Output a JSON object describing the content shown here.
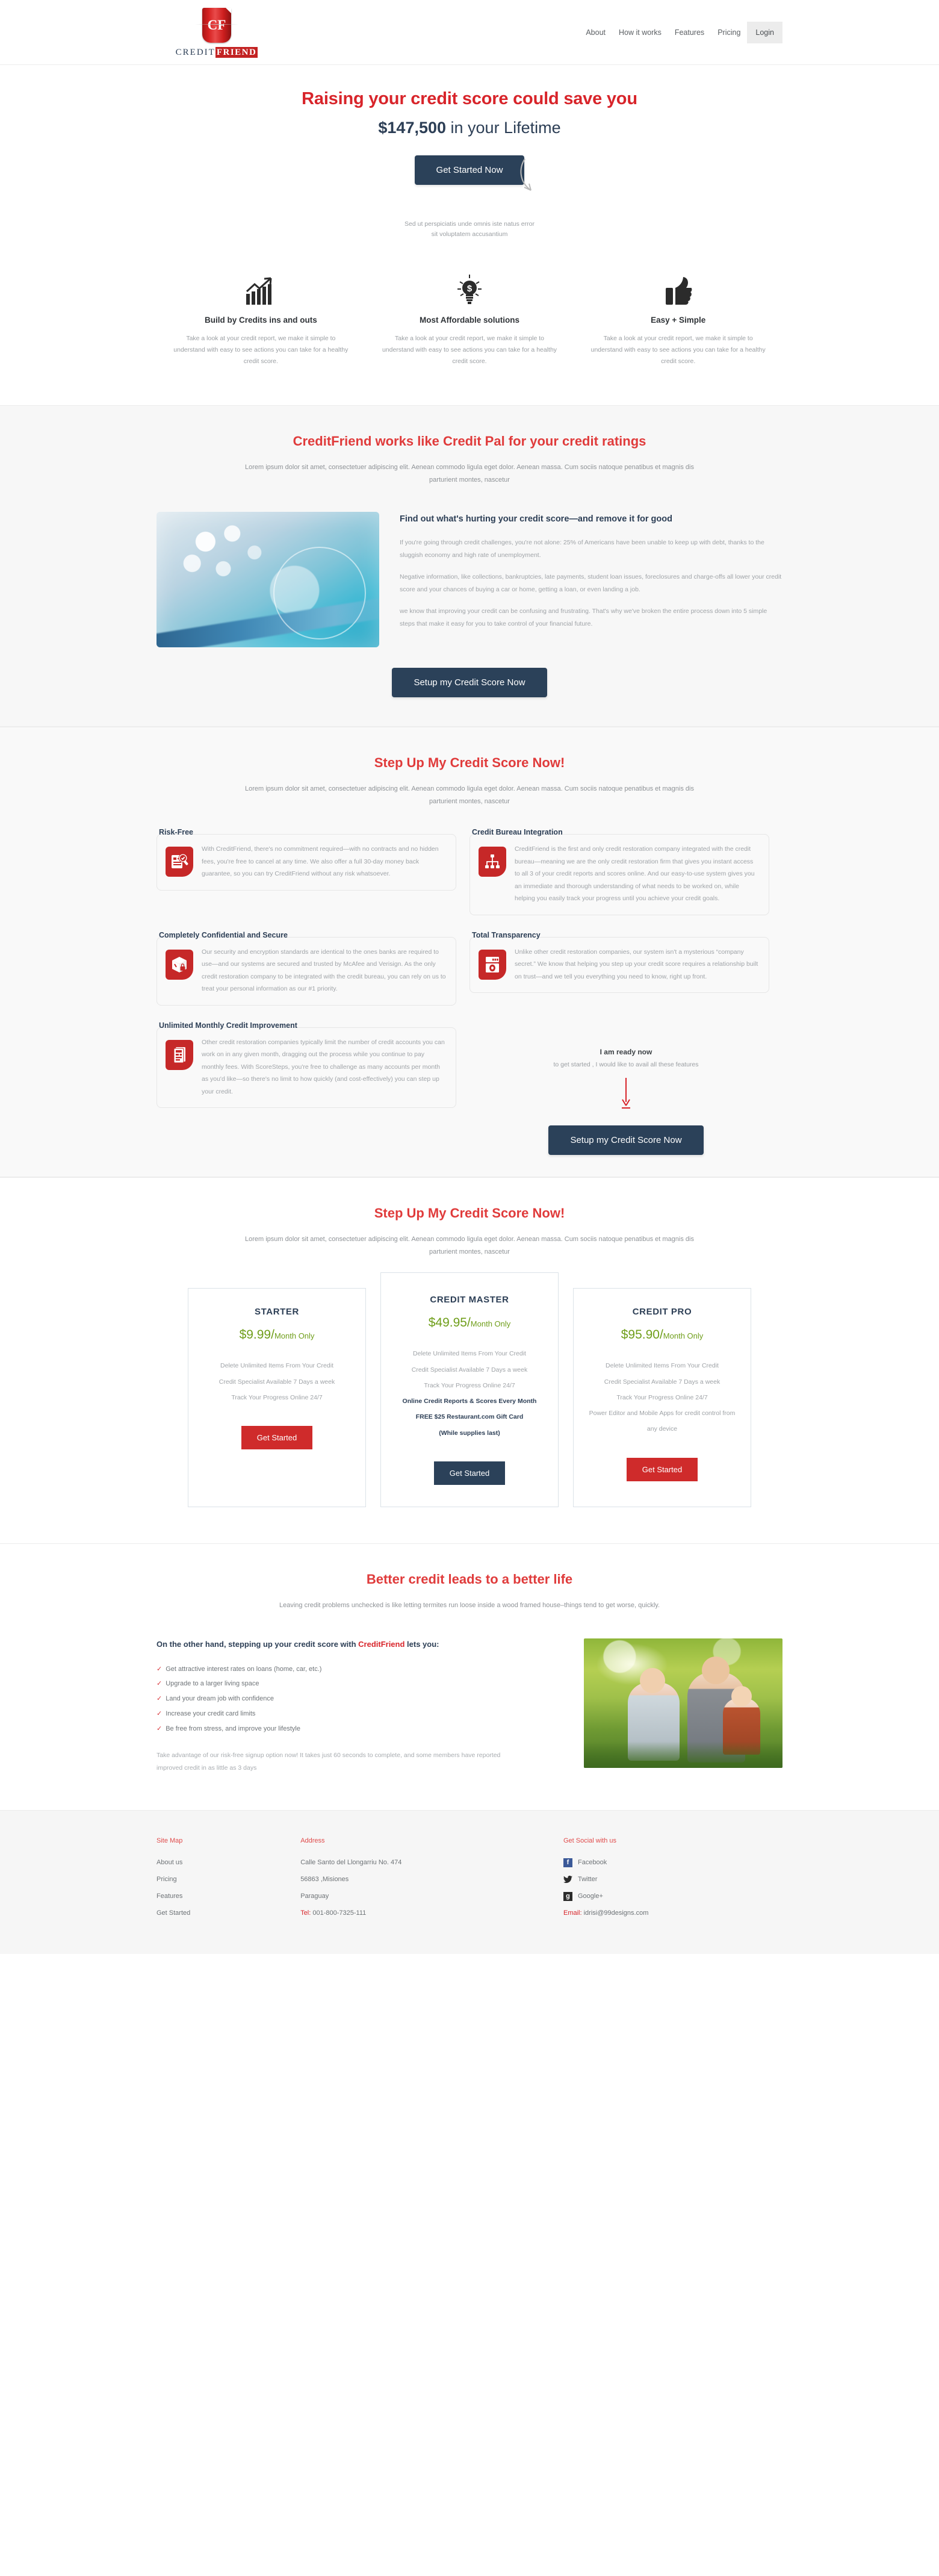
{
  "header": {
    "logo_mark": "CF",
    "logo_word_1": "CREDIT",
    "logo_word_2": "FRIEND",
    "nav": [
      {
        "label": "About"
      },
      {
        "label": "How it works"
      },
      {
        "label": "Features"
      },
      {
        "label": "Pricing"
      },
      {
        "label": "Login"
      }
    ]
  },
  "hero": {
    "headline": "Raising your credit score could save you",
    "amount": "$147,500",
    "subhead_rest": " in your Lifetime",
    "cta": "Get Started Now",
    "fineprint_line1": "Sed ut perspiciatis unde omnis iste natus error",
    "fineprint_line2": "sit voluptatem accusantium"
  },
  "tri_features": [
    {
      "icon": "growth-chart-icon",
      "title": "Build by Credits ins and outs",
      "text": "Take a look at your credit report, we make it simple to understand with easy to see actions you can take for a healthy credit score."
    },
    {
      "icon": "lightbulb-dollar-icon",
      "title": "Most Affordable solutions",
      "text": "Take a look at your credit report, we make it simple to understand with easy to see actions you can take for a healthy credit score."
    },
    {
      "icon": "thumbs-up-icon",
      "title": "Easy + Simple",
      "text": "Take a look at your credit report, we make it simple to understand with easy to see actions you can take for a healthy credit score."
    }
  ],
  "creditpal": {
    "title": "CreditFriend works like Credit Pal for your credit ratings",
    "lede": "Lorem ipsum dolor sit amet, consectetuer adipiscing elit. Aenean commodo ligula eget dolor. Aenean massa. Cum sociis natoque penatibus et magnis dis parturient montes, nascetur",
    "sub_title": "Find out what's hurting your credit score—and remove it for good",
    "p1": "If you're going through credit challenges, you're not alone: 25% of Americans have been unable to keep up with debt, thanks to the sluggish economy and high rate of unemployment.",
    "p2": "Negative information, like collections, bankruptcies, late payments, student loan issues, foreclosures and charge-offs all lower your credit score and your chances of buying a car or home, getting a loan, or even landing a job.",
    "p3": "we know that improving your credit can be confusing and frustrating. That's why we've broken the entire process down into 5 simple steps that make it easy for you to take control of your financial future.",
    "cta": "Setup my Credit Score Now"
  },
  "stepup": {
    "title": "Step Up My Credit Score Now!",
    "lede": "Lorem ipsum dolor sit amet, consectetuer adipiscing elit. Aenean commodo ligula eget dolor. Aenean massa. Cum sociis natoque penatibus et magnis dis parturient montes, nascetur",
    "cards": [
      {
        "icon": "document-check-magnifier-icon",
        "title": "Risk-Free",
        "text": "With CreditFriend, there's no commitment required—with no contracts and no hidden fees, you're free to cancel at any time. We also offer a full 30-day money back guarantee, so you can try CreditFriend without any risk whatsoever."
      },
      {
        "icon": "org-chart-icon",
        "title": "Credit Bureau Integration",
        "text": "CreditFriend is the first and only credit restoration company integrated with the credit bureau—meaning we are the only credit restoration firm that gives you instant access to all 3 of your credit reports and scores online. And our easy-to-use system gives you an immediate and thorough understanding of what needs to be worked on, while helping you easily track your progress until you achieve your credit goals."
      },
      {
        "icon": "lock-box-icon",
        "title": "Completely Confidential and Secure",
        "text": "Our security and encryption standards are identical to the ones banks are required to use—and our systems are secured and trusted by McAfee and Verisign. As the only credit restoration company to be integrated with the credit bureau, you can rely on us to treat your personal information as our #1 priority."
      },
      {
        "icon": "safe-vault-icon",
        "title": "Total Transparency",
        "text": "Unlike other credit restoration companies, our system isn't a mysterious “company secret.” We know that helping you step up your credit score requires a relationship built on trust—and we tell you everything you need to know, right up front."
      },
      {
        "icon": "newspaper-documents-icon",
        "title": "Unlimited Monthly Credit Improvement",
        "text": "Other credit restoration companies typically limit the number of credit accounts you can work on in any given month, dragging out the process while you continue to pay monthly fees. With ScoreSteps, you're free to challenge as many accounts per month as you'd like—so there's no limit to how quickly (and cost-effectively) you can step up your credit."
      }
    ],
    "ready_title": "I am ready now",
    "ready_sub": "to get started , I would like to avail all these features",
    "ready_cta": "Setup my Credit Score Now"
  },
  "pricing": {
    "title": "Step Up My Credit Score Now!",
    "lede": "Lorem ipsum dolor sit amet, consectetuer adipiscing elit. Aenean commodo ligula eget dolor. Aenean massa. Cum sociis natoque penatibus et magnis dis parturient montes, nascetur",
    "plans": [
      {
        "name": "STARTER",
        "price": "$9.99/",
        "period": "Month Only",
        "features": [
          {
            "text": "Delete Unlimited Items From Your Credit",
            "bold": false
          },
          {
            "text": "Credit Specialist Available 7 Days a week",
            "bold": false
          },
          {
            "text": "Track Your Progress Online 24/7",
            "bold": false
          }
        ],
        "cta": "Get Started",
        "cta_style": "red"
      },
      {
        "name": "CREDIT MASTER",
        "price": "$49.95/",
        "period": "Month Only",
        "features": [
          {
            "text": "Delete Unlimited Items From Your Credit",
            "bold": false
          },
          {
            "text": "Credit Specialist Available 7 Days a week",
            "bold": false
          },
          {
            "text": "Track Your Progress Online 24/7",
            "bold": false
          },
          {
            "text": "Online Credit Reports & Scores Every Month",
            "bold": true
          },
          {
            "text": "FREE $25 Restaurant.com Gift Card",
            "bold": true
          },
          {
            "text": "(While supplies last)",
            "bold": true
          }
        ],
        "cta": "Get Started",
        "cta_style": "navy"
      },
      {
        "name": "CREDIT PRO",
        "price": "$95.90/",
        "period": "Month Only",
        "features": [
          {
            "text": "Delete Unlimited Items From Your Credit",
            "bold": false
          },
          {
            "text": "Credit Specialist Available 7 Days a week",
            "bold": false
          },
          {
            "text": "Track Your Progress Online 24/7",
            "bold": false
          },
          {
            "text": "Power Editor and Mobile Apps for credit control from any device",
            "bold": false
          }
        ],
        "cta": "Get Started",
        "cta_style": "red"
      }
    ]
  },
  "better": {
    "title": "Better credit leads to a better life",
    "lede": "Leaving credit problems unchecked is like letting termites run loose inside a wood framed house–things tend to get worse, quickly.",
    "heading_pre": "On the other hand, stepping up your credit score with ",
    "heading_brand": "CreditFriend",
    "heading_post": " lets you:",
    "benefits": [
      "Get attractive interest rates on loans (home, car, etc.)",
      "Upgrade to a larger living space",
      "Land your dream job with confidence",
      "Increase your credit card limits",
      "Be free from stress, and improve your lifestyle"
    ],
    "note": "Take advantage of our risk-free signup option now! It takes just 60 seconds to complete, and some members have reported improved credit in as little as 3 days"
  },
  "footer": {
    "sitemap_title": "Site Map",
    "sitemap": [
      "About us",
      "Pricing",
      "Features",
      "Get Started"
    ],
    "address_title": "Address",
    "address_lines": [
      "Calle Santo del Llongarriu No. 474",
      "56863 ,Misiones",
      "Paraguay"
    ],
    "tel_label": "Tel:",
    "tel_value": " 001-800-7325-111",
    "social_title": "Get Social with us",
    "social": [
      {
        "name": "Facebook",
        "glyph": "f",
        "icon": "facebook-icon"
      },
      {
        "name": "Twitter",
        "glyph": "ᵕ",
        "icon": "twitter-icon"
      },
      {
        "name": "Google+",
        "glyph": "g",
        "icon": "google-plus-icon"
      }
    ],
    "email_label": "Email:",
    "email_value": " idrisi@99designs.com"
  },
  "colors": {
    "brand_red": "#d8242a",
    "navy": "#2b4159",
    "green": "#6f9e1a",
    "icon_red": "#c62828"
  }
}
